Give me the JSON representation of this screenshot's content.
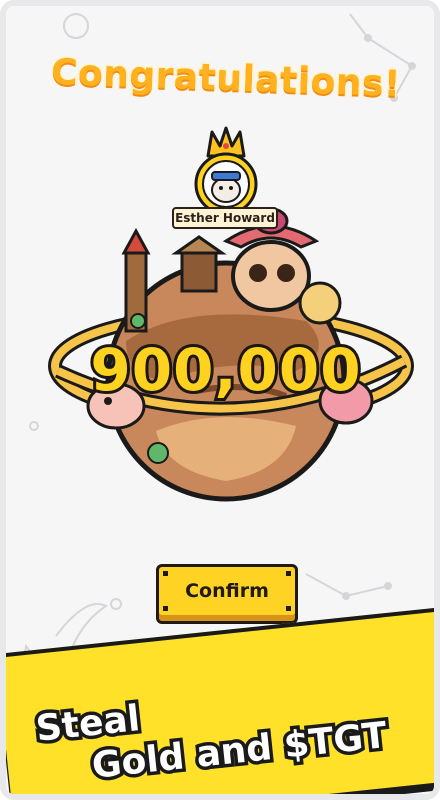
{
  "screen": {
    "title": "Congratulations!",
    "player_name": "Esther Howard",
    "reward_amount": "900,000",
    "confirm_label": "Confirm",
    "slogan_line1": "Steal",
    "slogan_line2": "Gold and $TGT"
  },
  "colors": {
    "title": "#ffb11f",
    "amount": "#ffd21f",
    "button": "#ffd324",
    "banner": "#ffe12a",
    "outline": "#1d1712"
  },
  "icons": [
    "crown-icon",
    "cat-avatar-icon",
    "planet-illustration"
  ]
}
